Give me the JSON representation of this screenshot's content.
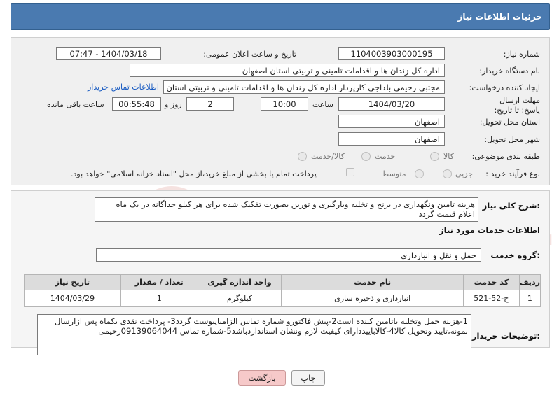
{
  "header": {
    "title": "جزئیات اطلاعات نیاز"
  },
  "form": {
    "need_number_label": "شماره نیاز:",
    "need_number": "1104003903000195",
    "announce_label": "تاریخ و ساعت اعلان عمومی:",
    "announce_value": "1404/03/18 - 07:47",
    "buyer_org_label": "نام دستگاه خریدار:",
    "buyer_org": "اداره کل زندان ها و اقدامات تامینی و تربیتی استان اصفهان",
    "requester_label": "ایجاد کننده درخواست:",
    "requester": "مجتبی رحیمی بلداجی کارپرداز اداره کل زندان ها و اقدامات تامینی و تربیتی استان",
    "contact_link": "اطلاعات تماس خریدار",
    "deadline_label": "مهلت ارسال پاسخ: تا تاریخ:",
    "deadline_date": "1404/03/20",
    "time_label": "ساعت",
    "deadline_time": "10:00",
    "days_value": "2",
    "days_label": "روز و",
    "remaining_time": "00:55:48",
    "remaining_label": "ساعت باقی مانده",
    "province_label": "استان محل تحویل:",
    "province": "اصفهان",
    "city_label": "شهر محل تحویل:",
    "city": "اصفهان",
    "category_label": "طبقه بندی موضوعی:",
    "category_options": [
      "کالا",
      "خدمت",
      "کالا/خدمت"
    ],
    "process_label": "نوع فرآیند خرید :",
    "process_options": [
      "جزیی",
      "متوسط"
    ],
    "payment_note": "پرداخت تمام یا بخشی از مبلغ خرید،از محل \"اسناد خزانه اسلامی\" خواهد بود."
  },
  "description": {
    "label": "شرح کلی نیاز:",
    "text": "هزینه تامین ونگهداری در برنج  و تخلیه وبارگیری و توزین  بصورت تفکیک شده برای هر کیلو جداگانه در یک ماه اعلام قیمت گردد",
    "services_title": "اطلاعات خدمات مورد نیاز",
    "service_group_label": "گروه خدمت:",
    "service_group": "حمل و نقل و انبارداری"
  },
  "table": {
    "headers": [
      "ردیف",
      "کد خدمت",
      "نام خدمت",
      "واحد اندازه گیری",
      "تعداد / مقدار",
      "تاریخ نیاز"
    ],
    "rows": [
      [
        "1",
        "ح-52-521",
        "انبارداری و ذخیره سازی",
        "کیلوگرم",
        "1",
        "1404/03/29"
      ]
    ]
  },
  "buyer_notes": {
    "label": "توضیحات خریدار:",
    "text": "1-هزینه حمل وتخلیه باتامین کننده است2-پیش فاکتورو شماره تماس الزامیاپیوست گردد3- پرداخت نقدی یکماه  پس ازارسال نمونه،تایید وتحویل کالا4-کالاباییددارای کیفیت لازم ونشان استانداردباشد5-شماره تماس 09139064044رحیمی"
  },
  "buttons": {
    "print": "چاپ",
    "back": "بازگشت"
  },
  "watermark": {
    "text": "AriaTender.neT"
  },
  "colors": {
    "header": "#4a7ab0",
    "link": "#1a5cc2",
    "back_button": "#f6c9c9"
  }
}
